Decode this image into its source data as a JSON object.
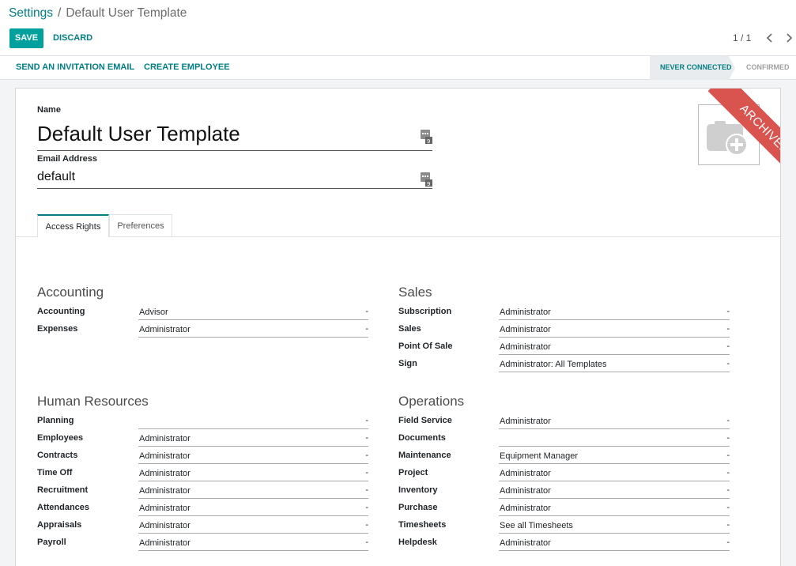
{
  "breadcrumb": {
    "parent": "Settings",
    "separator": "/",
    "current": "Default User Template"
  },
  "buttons": {
    "save": "SAVE",
    "discard": "DISCARD"
  },
  "pager": {
    "value": "1 / 1"
  },
  "statusbar": {
    "actions": {
      "invite": "SEND AN INVITATION EMAIL",
      "create_employee": "CREATE EMPLOYEE"
    },
    "stages": {
      "current": "NEVER CONNECTED",
      "next": "CONFIRMED"
    }
  },
  "form": {
    "name_label": "Name",
    "name_value": "Default User Template",
    "email_label": "Email Address",
    "email_value": "default",
    "ribbon": "ARCHIVED"
  },
  "tabs": {
    "access_rights": "Access Rights",
    "preferences": "Preferences"
  },
  "groups": {
    "accounting": {
      "title": "Accounting",
      "fields": [
        {
          "label": "Accounting",
          "value": "Advisor"
        },
        {
          "label": "Expenses",
          "value": "Administrator"
        }
      ]
    },
    "sales": {
      "title": "Sales",
      "fields": [
        {
          "label": "Subscription",
          "value": "Administrator"
        },
        {
          "label": "Sales",
          "value": "Administrator"
        },
        {
          "label": "Point Of Sale",
          "value": "Administrator"
        },
        {
          "label": "Sign",
          "value": "Administrator: All Templates"
        }
      ]
    },
    "hr": {
      "title": "Human Resources",
      "fields": [
        {
          "label": "Planning",
          "value": ""
        },
        {
          "label": "Employees",
          "value": "Administrator"
        },
        {
          "label": "Contracts",
          "value": "Administrator"
        },
        {
          "label": "Time Off",
          "value": "Administrator"
        },
        {
          "label": "Recruitment",
          "value": "Administrator"
        },
        {
          "label": "Attendances",
          "value": "Administrator"
        },
        {
          "label": "Appraisals",
          "value": "Administrator"
        },
        {
          "label": "Payroll",
          "value": "Administrator"
        }
      ]
    },
    "operations": {
      "title": "Operations",
      "fields": [
        {
          "label": "Field Service",
          "value": "Administrator"
        },
        {
          "label": "Documents",
          "value": ""
        },
        {
          "label": "Maintenance",
          "value": "Equipment Manager"
        },
        {
          "label": "Project",
          "value": "Administrator"
        },
        {
          "label": "Inventory",
          "value": "Administrator"
        },
        {
          "label": "Purchase",
          "value": "Administrator"
        },
        {
          "label": "Timesheets",
          "value": "See all Timesheets"
        },
        {
          "label": "Helpdesk",
          "value": "Administrator"
        }
      ]
    }
  },
  "select_dash": "-",
  "icons": {
    "prev": "chevron-left-icon",
    "next": "chevron-right-icon",
    "translate": "translate-icon",
    "avatar": "camera-plus-icon"
  },
  "colors": {
    "primary": "#00a09d",
    "link": "#017e84",
    "ribbon": "#d9534f"
  }
}
